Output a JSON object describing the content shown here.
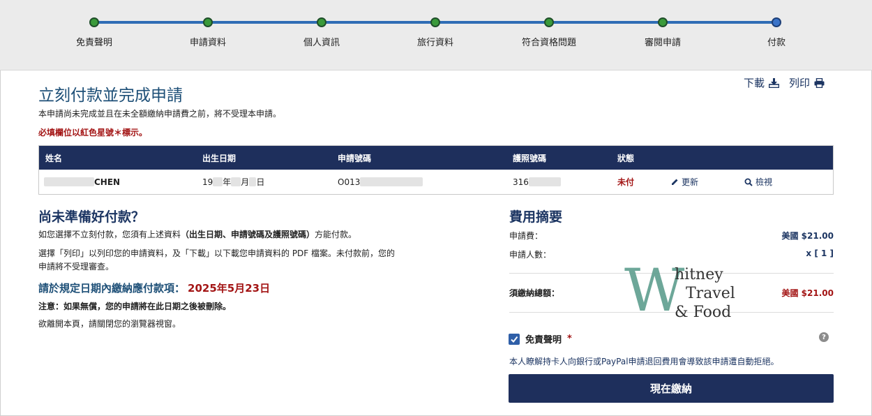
{
  "progress": {
    "steps": [
      {
        "label": "免責聲明",
        "state": "done"
      },
      {
        "label": "申請資料",
        "state": "done"
      },
      {
        "label": "個人資訊",
        "state": "done"
      },
      {
        "label": "旅行資料",
        "state": "done"
      },
      {
        "label": "符合資格問題",
        "state": "done"
      },
      {
        "label": "審閱申請",
        "state": "done"
      },
      {
        "label": "付款",
        "state": "current"
      }
    ]
  },
  "header": {
    "title": "立刻付款並完成申請",
    "download_label": "下載",
    "print_label": "列印",
    "intro": "本申請尚未完成並且在未全額繳納申請費之前，將不受理本申請。",
    "required_note": "必填欄位以紅色星號＊標示。"
  },
  "table": {
    "headers": [
      "姓名",
      "出生日期",
      "申請號碼",
      "護照號碼",
      "狀態"
    ],
    "row": {
      "name": "CHEN",
      "birth_prefix": "19",
      "birth_year": "年",
      "birth_month": "月",
      "birth_day": "日",
      "application_no": "O013",
      "passport_no": "316",
      "status": "未付",
      "update_label": "更新",
      "view_label": "檢視"
    }
  },
  "not_ready": {
    "title": "尚未準備好付款？",
    "p1_pre": "如您選擇不立刻付款，您須有上述資料",
    "p1_bold": "（出生日期、申請號碼及護照號碼）",
    "p1_post": "方能付款。",
    "p2_line1": "選擇「列印」以列印您的申請資料，及「下載」以下載您申請資料的 PDF 檔案。未付款前，您的",
    "p2_line2": "申請將不受理審查。",
    "deadline_label": "請於規定日期內繳納應付款項：",
    "deadline_date": "2025年5月23日",
    "note": "注意：如果無償，您的申請將在此日期之後被刪除。",
    "leave": "欲離開本頁，請關閉您的瀏覽器視窗。"
  },
  "fee_summary": {
    "title": "費用摘要",
    "fee_label": "申請費：",
    "fee_value": "美國 $21.00",
    "count_label": "申請人數：",
    "count_value": "x [ 1 ]",
    "total_label": "須繳納總額：",
    "total_value": "美國 $21.00"
  },
  "disclaimer": {
    "label": "免責聲明",
    "required_mark": "*",
    "checked": true,
    "agree_text": "本人瞭解持卡人向銀行或PayPal申請退回費用會導致該申請遭自動拒絕。"
  },
  "pay_button": "現在繳納",
  "watermark": {
    "lines": [
      "hitney",
      "Travel",
      "& Food"
    ],
    "initial": "W"
  },
  "colors": {
    "navy": "#1e2f5c",
    "title_blue": "#1d4f77",
    "required_red": "#a31515",
    "step_done": "#3a9a3a",
    "step_current": "#3b74c9",
    "track": "#2f6db5",
    "logo_teal": "#5e9e8e"
  }
}
